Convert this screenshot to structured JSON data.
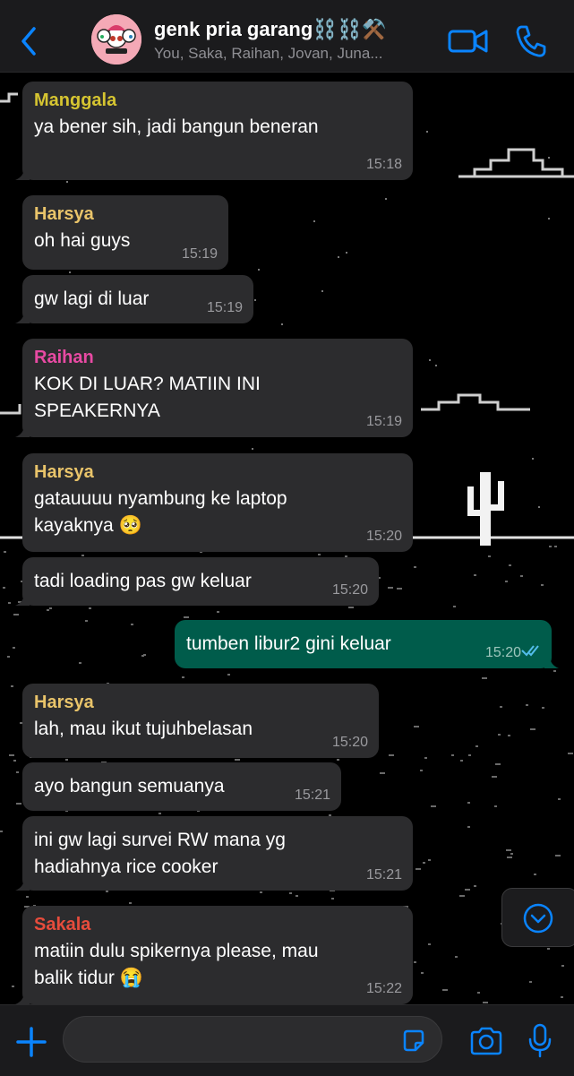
{
  "header": {
    "title": "genk pria garang⛓️⛓️⚒️",
    "subtitle": "You, Saka, Raihan, Jovan, Juna...",
    "accent": "#0a84ff"
  },
  "messages": [
    {
      "id": "m1",
      "sender": "Manggala",
      "sender_color": "#d6c531",
      "lines": [
        "ya bener sih, jadi bangun beneran"
      ],
      "time": "15:18",
      "dir": "in"
    },
    {
      "id": "m2",
      "sender": "Harsya",
      "sender_color": "#e9c46a",
      "lines": [
        "oh hai guys"
      ],
      "time": "15:19",
      "dir": "in"
    },
    {
      "id": "m3",
      "sender": "",
      "lines": [
        "gw lagi di luar"
      ],
      "time": "15:19",
      "dir": "in"
    },
    {
      "id": "m4",
      "sender": "Raihan",
      "sender_color": "#e84aa3",
      "lines": [
        "KOK DI LUAR? MATIIN INI",
        "SPEAKERNYA"
      ],
      "time": "15:19",
      "dir": "in"
    },
    {
      "id": "m5",
      "sender": "Harsya",
      "sender_color": "#e9c46a",
      "lines": [
        "gatauuuu nyambung ke laptop",
        "kayaknya 🥺"
      ],
      "time": "15:20",
      "dir": "in"
    },
    {
      "id": "m6",
      "sender": "",
      "lines": [
        "tadi loading pas gw keluar"
      ],
      "time": "15:20",
      "dir": "in"
    },
    {
      "id": "m7",
      "sender": "",
      "lines": [
        "tumben libur2 gini keluar"
      ],
      "time": "15:20",
      "dir": "out",
      "status": "read"
    },
    {
      "id": "m8",
      "sender": "Harsya",
      "sender_color": "#e9c46a",
      "lines": [
        "lah, mau ikut tujuhbelasan"
      ],
      "time": "15:20",
      "dir": "in"
    },
    {
      "id": "m9",
      "sender": "",
      "lines": [
        "ayo bangun semuanya"
      ],
      "time": "15:21",
      "dir": "in"
    },
    {
      "id": "m10",
      "sender": "",
      "lines": [
        "ini gw lagi survei RW mana yg",
        "hadiahnya rice cooker"
      ],
      "time": "15:21",
      "dir": "in"
    },
    {
      "id": "m11",
      "sender": "Sakala",
      "sender_color": "#e74c3c",
      "lines": [
        "matiin dulu spikernya please, mau",
        "balik tidur 😭"
      ],
      "time": "15:22",
      "dir": "in"
    }
  ],
  "input": {
    "value": "",
    "placeholder": ""
  },
  "icons": {
    "back": "chevron-left-icon",
    "video": "video-camera-icon",
    "call": "phone-icon",
    "plus": "plus-icon",
    "sticker": "sticker-icon",
    "camera": "camera-icon",
    "mic": "microphone-icon",
    "scroll": "chevron-down-circle-icon"
  }
}
